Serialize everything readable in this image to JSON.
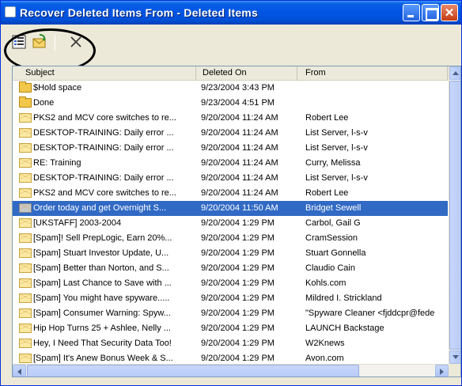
{
  "window": {
    "title": "Recover Deleted Items From - Deleted Items",
    "close_glyph": "✕"
  },
  "toolbar": {
    "buttons": [
      {
        "name": "select-all-icon"
      },
      {
        "name": "recover-selected-items-icon"
      },
      {
        "name": "purge-selected-items-icon",
        "glyph": "✕"
      }
    ],
    "highlight_circle": true
  },
  "list": {
    "columns": [
      "Subject",
      "Deleted On",
      "From"
    ],
    "rows": [
      {
        "icon": "folder",
        "subject": "$Hold space",
        "deleted_on": "9/23/2004 3:43 PM",
        "from": ""
      },
      {
        "icon": "folder",
        "subject": "Done",
        "deleted_on": "9/23/2004 4:51 PM",
        "from": ""
      },
      {
        "icon": "mail",
        "subject": "PKS2 and MCV core switches to re...",
        "deleted_on": "9/20/2004 11:24 AM",
        "from": "Robert Lee"
      },
      {
        "icon": "mail",
        "subject": "DESKTOP-TRAINING: Daily error ...",
        "deleted_on": "9/20/2004 11:24 AM",
        "from": "List Server, l-s-v"
      },
      {
        "icon": "mail",
        "subject": "DESKTOP-TRAINING: Daily error ...",
        "deleted_on": "9/20/2004 11:24 AM",
        "from": "List Server, l-s-v"
      },
      {
        "icon": "mail",
        "subject": "RE: Training",
        "deleted_on": "9/20/2004 11:24 AM",
        "from": "Curry, Melissa"
      },
      {
        "icon": "mail",
        "subject": "DESKTOP-TRAINING: Daily error ...",
        "deleted_on": "9/20/2004 11:24 AM",
        "from": "List Server, l-s-v"
      },
      {
        "icon": "mail",
        "subject": "PKS2 and MCV core switches to re...",
        "deleted_on": "9/20/2004 11:24 AM",
        "from": "Robert Lee"
      },
      {
        "icon": "mail-read",
        "subject": "Order today and get Overnight S...",
        "deleted_on": "9/20/2004 11:50 AM",
        "from": "Bridget Sewell",
        "selected": true
      },
      {
        "icon": "mail",
        "subject": "[UKSTAFF] 2003-2004",
        "deleted_on": "9/20/2004 1:29 PM",
        "from": "Carbol, Gail G"
      },
      {
        "icon": "mail",
        "subject": "[Spam]! Sell PrepLogic, Earn 20%...",
        "deleted_on": "9/20/2004 1:29 PM",
        "from": "CramSession"
      },
      {
        "icon": "mail",
        "subject": "[Spam] Stuart Investor Update, U...",
        "deleted_on": "9/20/2004 1:29 PM",
        "from": "Stuart Gonnella"
      },
      {
        "icon": "mail",
        "subject": "[Spam] Better than Norton, and S...",
        "deleted_on": "9/20/2004 1:29 PM",
        "from": "Claudio Cain"
      },
      {
        "icon": "mail",
        "subject": "[Spam] Last Chance to Save with ...",
        "deleted_on": "9/20/2004 1:29 PM",
        "from": "Kohls.com"
      },
      {
        "icon": "mail",
        "subject": "[Spam] You might have spyware.....",
        "deleted_on": "9/20/2004 1:29 PM",
        "from": "Mildred I. Strickland"
      },
      {
        "icon": "mail",
        "subject": "[Spam] Consumer Warning: Spyw...",
        "deleted_on": "9/20/2004 1:29 PM",
        "from": "\"Spyware Cleaner <fjddcpr@fede"
      },
      {
        "icon": "mail",
        "subject": "Hip Hop Turns 25 + Ashlee, Nelly ...",
        "deleted_on": "9/20/2004 1:29 PM",
        "from": "LAUNCH Backstage"
      },
      {
        "icon": "mail",
        "subject": "Hey, I Need That Security Data Too!",
        "deleted_on": "9/20/2004 1:29 PM",
        "from": "W2Knews"
      },
      {
        "icon": "mail",
        "subject": "[Spam] It's Anew Bonus Week & S...",
        "deleted_on": "9/20/2004 1:29 PM",
        "from": "Avon.com"
      }
    ]
  },
  "colors": {
    "titlebar": "#0054e3",
    "selection": "#316ac5",
    "window_bg": "#ece9d8"
  }
}
